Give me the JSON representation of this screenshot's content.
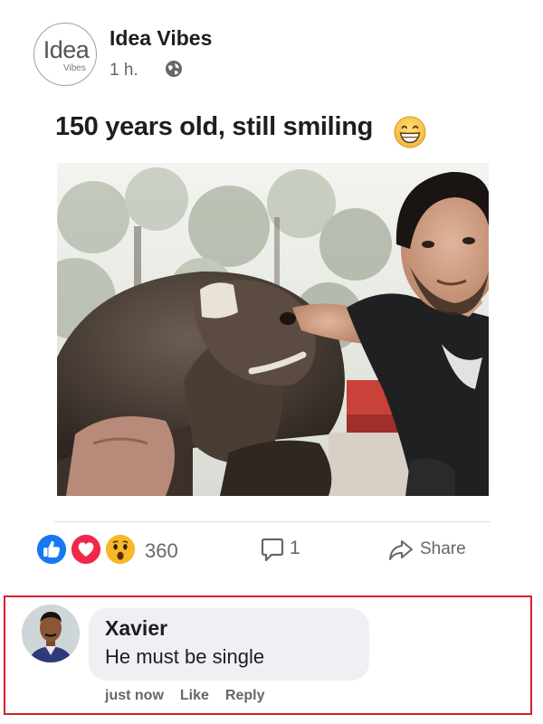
{
  "post": {
    "page_name": "Idea Vibes",
    "logo_text": "Idea",
    "logo_subtext": "Vibes",
    "time": "1 h.",
    "privacy_icon": "globe-icon",
    "text": "150 years old, still smiling",
    "text_emoji": "grinning-face-icon"
  },
  "engagement": {
    "reaction_icons": [
      "like-icon",
      "love-icon",
      "wow-icon"
    ],
    "reaction_count": "360",
    "comment_count": "1",
    "share_label": "Share"
  },
  "comment": {
    "author": "Xavier",
    "text": "He must be single",
    "time": "just now",
    "like_label": "Like",
    "reply_label": "Reply"
  },
  "colors": {
    "like_blue": "#1877f2",
    "love_red": "#f02849",
    "wow_yellow": "#f7b928",
    "highlight_border": "#d6212b"
  }
}
